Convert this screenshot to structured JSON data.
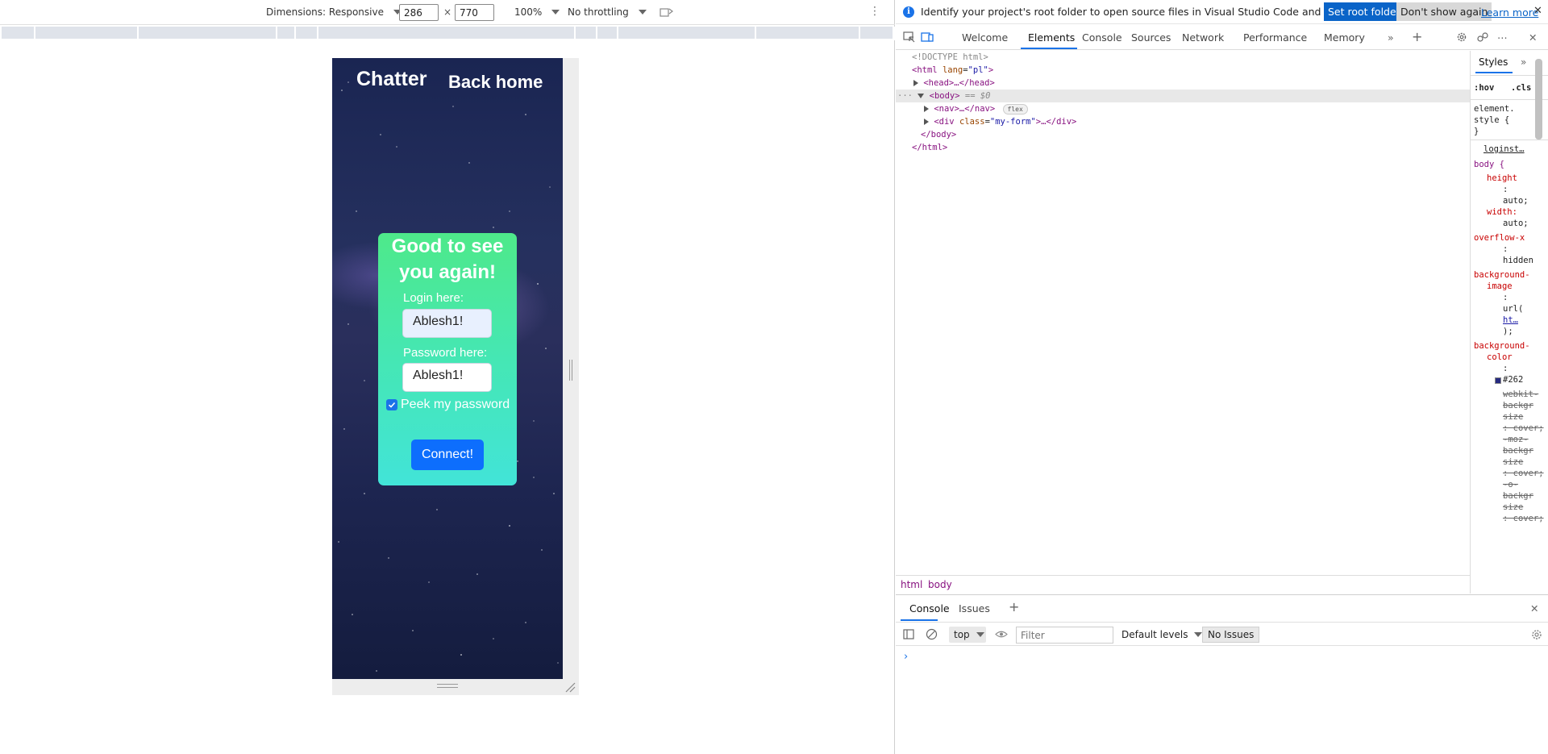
{
  "emulation": {
    "dimensions_label": "Dimensions: Responsive",
    "width_value": "286",
    "height_value": "770",
    "times_sign": "×",
    "zoom": "100%",
    "throttling": "No throttling",
    "more": "⋮"
  },
  "page": {
    "brand": "Chatter",
    "back_home": "Back home",
    "form": {
      "title": "Good to see you again!",
      "login_label": "Login here:",
      "login_value": "Ablesh1!",
      "password_label": "Password here:",
      "password_value": "Ablesh1!",
      "peek_label": "Peek my password",
      "peek_checked": true,
      "connect_label": "Connect!"
    }
  },
  "devtools": {
    "infobar": {
      "message": "Identify your project's root folder to open source files in Visual Studio Code and sync changes.",
      "primary_button": "Set root folder",
      "secondary_button": "Don't show again",
      "link": "Learn more",
      "close": "✕"
    },
    "tabs": [
      "Welcome",
      "Elements",
      "Console",
      "Sources",
      "Network",
      "Performance",
      "Memory"
    ],
    "active_tab": "Elements",
    "dom": {
      "doctype": "<!DOCTYPE html>",
      "html_open": "<html",
      "html_attr_name": "lang",
      "html_attr_value": "\"pl\"",
      "html_close_bracket": ">",
      "head": "<head>…</head>",
      "body_open": "<body>",
      "body_selected_marker": "== $0",
      "nav": "<nav>…</nav>",
      "nav_badge": "flex",
      "div_open": "<div",
      "div_attr_name": "class",
      "div_attr_value": "\"my-form\"",
      "div_rest": ">…</div>",
      "body_close": "</body>",
      "html_close": "</html>",
      "ellipsis": "···"
    },
    "breadcrumbs": [
      "html",
      "body"
    ],
    "styles": {
      "tab_label": "Styles",
      "hov": ":hov",
      "cls": ".cls",
      "element_style_1": "element.",
      "element_style_2": "style {",
      "element_style_3": "}",
      "source_link": "loginst…",
      "selector": "body {",
      "lines": [
        {
          "text": "height",
          "kind": "prop"
        },
        {
          "text": ":",
          "kind": "plain"
        },
        {
          "text": "auto;",
          "kind": "plain"
        },
        {
          "text": "width:",
          "kind": "prop"
        },
        {
          "text": "auto;",
          "kind": "plain"
        },
        {
          "text": "overflow-x",
          "kind": "prop"
        },
        {
          "text": ":",
          "kind": "plain"
        },
        {
          "text": "hidden",
          "kind": "plain"
        },
        {
          "text": "background-",
          "kind": "prop"
        },
        {
          "text": "image",
          "kind": "prop"
        },
        {
          "text": ":",
          "kind": "plain"
        },
        {
          "text": "url(",
          "kind": "plain"
        },
        {
          "text": "ht…",
          "kind": "link"
        },
        {
          "text": ");",
          "kind": "plain"
        },
        {
          "text": "background-",
          "kind": "prop"
        },
        {
          "text": "color",
          "kind": "prop"
        },
        {
          "text": ":",
          "kind": "plain"
        },
        {
          "text": "#262",
          "kind": "swatch"
        },
        {
          "text": "webkit-",
          "kind": "strike"
        },
        {
          "text": "backgr",
          "kind": "strike"
        },
        {
          "text": "size",
          "kind": "strike"
        },
        {
          "text": ": cover;",
          "kind": "strike"
        },
        {
          "text": "-moz-",
          "kind": "strike"
        },
        {
          "text": "backgr",
          "kind": "strike"
        },
        {
          "text": "size",
          "kind": "strike"
        },
        {
          "text": ": cover;",
          "kind": "strike"
        },
        {
          "text": "-o-",
          "kind": "strike"
        },
        {
          "text": "backgr",
          "kind": "strike"
        },
        {
          "text": "size",
          "kind": "strike"
        },
        {
          "text": ": cover;",
          "kind": "strike"
        }
      ]
    },
    "console": {
      "tabs": [
        "Console",
        "Issues"
      ],
      "context": "top",
      "filter_placeholder": "Filter",
      "levels": "Default levels",
      "issues": "No Issues",
      "prompt": "›"
    },
    "colors": {
      "accent": "#1a73e8",
      "primary_button": "#0a64c8",
      "swatch": "#262a80"
    }
  }
}
